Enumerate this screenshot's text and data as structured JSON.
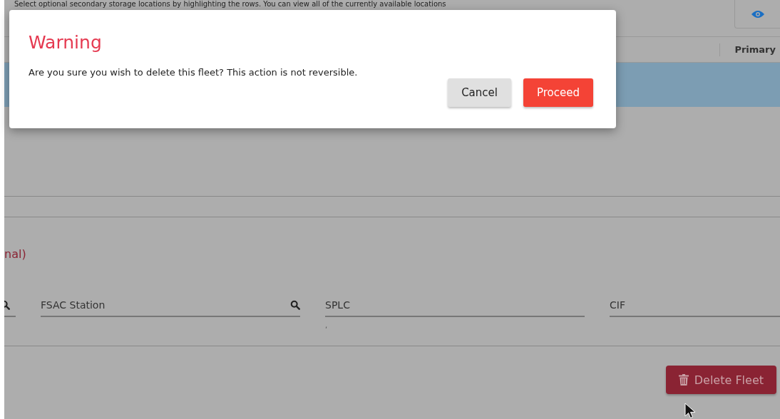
{
  "background": {
    "intro_text": "Select optional secondary storage locations by highlighting the rows. You can view all of the currently available locations",
    "column_header": "Primary",
    "section_title": "nal)",
    "fields": [
      {
        "kind": "search"
      },
      {
        "kind": "search",
        "label": "FSAC Station"
      },
      {
        "kind": "plain",
        "label": "SPLC",
        "hint": ","
      },
      {
        "kind": "plain",
        "label": "CIF"
      }
    ],
    "delete_button": "Delete Fleet"
  },
  "dialog": {
    "title": "Warning",
    "message": "Are you sure you wish to delete this fleet? This action is not reversible.",
    "buttons": [
      {
        "label": "Cancel",
        "kind": "secondary"
      },
      {
        "label": "Proceed",
        "kind": "primary"
      }
    ]
  }
}
